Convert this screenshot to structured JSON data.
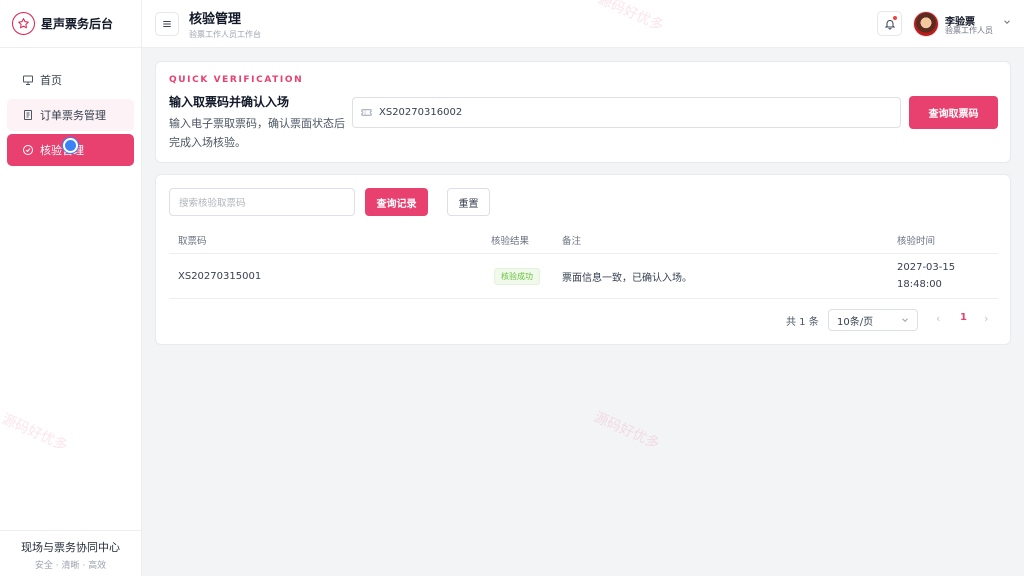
{
  "brand": {
    "title": "星声票务后台"
  },
  "sidebar": {
    "items": [
      {
        "label": "首页",
        "icon": "presentation-board-icon"
      },
      {
        "label": "订单票务管理",
        "icon": "document-list-icon"
      },
      {
        "label": "核验管理",
        "icon": "check-circle-icon"
      }
    ],
    "footer_title": "现场与票务协同中心",
    "footer_sub": "安全 · 清晰 · 高效"
  },
  "header": {
    "title": "核验管理",
    "subtitle": "验票工作人员工作台",
    "user_name": "李验票",
    "user_role": "验票工作人员"
  },
  "quick": {
    "eyebrow": "QUICK VERIFICATION",
    "title": "输入取票码并确认入场",
    "desc": "输入电子票取票码，确认票面状态后完成入场核验。",
    "input_value": "XS20270316002",
    "button": "查询取票码"
  },
  "records": {
    "search_placeholder": "搜索核验取票码",
    "query_button": "查询记录",
    "reset_button": "重置",
    "columns": [
      "取票码",
      "核验结果",
      "备注",
      "核验时间"
    ],
    "rows": [
      {
        "code": "XS20270315001",
        "result": "核验成功",
        "note": "票面信息一致，已确认入场。",
        "date": "2027-03-15",
        "time": "18:48:00"
      }
    ]
  },
  "pagination": {
    "total": "共 1 条",
    "page_size": "10条/页",
    "current": "1"
  },
  "watermark": "源码好优多",
  "colors": {
    "accent": "#e8416f",
    "success": "#67c23a"
  }
}
